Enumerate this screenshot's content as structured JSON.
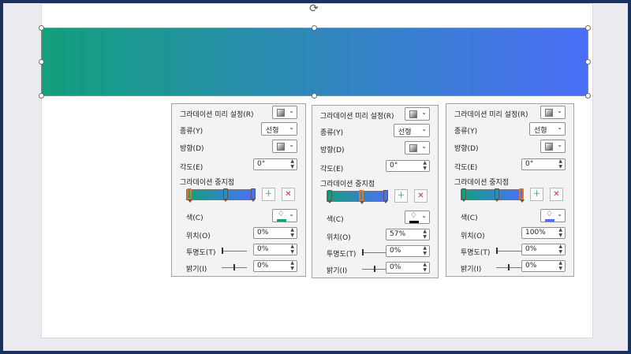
{
  "colors": {
    "gradient_start": "#12a07c",
    "gradient_end": "#4b6ef7",
    "selected_stop_border": "#d9772b"
  },
  "icons": {
    "rotate": "rotate-handle-icon",
    "add_stop": "add-gradient-stop-icon",
    "remove_stop": "remove-gradient-stop-icon",
    "paint": "paint-bucket-icon"
  },
  "panels": [
    {
      "preset_label": "그라데이션 미리 설정(R)",
      "type_label": "종류(Y)",
      "type_value": "선형",
      "direction_label": "방향(D)",
      "angle_label": "각도(E)",
      "angle_value": "0°",
      "stops_label": "그라데이션 중지점",
      "color_label": "색(C)",
      "color_swatch": "#12a07c",
      "position_label": "위치(O)",
      "position_value": "0%",
      "transparency_label": "투명도(T)",
      "transparency_value": "0%",
      "brightness_label": "밝기(I)",
      "brightness_value": "0%",
      "selected_stop": 0
    },
    {
      "preset_label": "그라데이션 미리 설정(R)",
      "type_label": "종류(Y)",
      "type_value": "선형",
      "direction_label": "방향(D)",
      "angle_label": "각도(E)",
      "angle_value": "0°",
      "stops_label": "그라데이션 중지점",
      "color_label": "색(C)",
      "color_swatch": "#000000",
      "position_label": "위치(O)",
      "position_value": "57%",
      "transparency_label": "투명도(T)",
      "transparency_value": "0%",
      "brightness_label": "밝기(I)",
      "brightness_value": "0%",
      "selected_stop": 1
    },
    {
      "preset_label": "그라데이션 미리 설정(R)",
      "type_label": "종류(Y)",
      "type_value": "선형",
      "direction_label": "방향(D)",
      "angle_label": "각도(E)",
      "angle_value": "0°",
      "stops_label": "그라데이션 중지점",
      "color_label": "색(C)",
      "color_swatch": "#4b6ef7",
      "position_label": "위치(O)",
      "position_value": "100%",
      "transparency_label": "투명도(T)",
      "transparency_value": "0%",
      "brightness_label": "밝기(I)",
      "brightness_value": "0%",
      "selected_stop": 2
    }
  ],
  "gradient_stops": [
    {
      "position": 0,
      "color": "#12a07c"
    },
    {
      "position": 57,
      "color": "#2a8fb0"
    },
    {
      "position": 100,
      "color": "#4b6ef7"
    }
  ]
}
